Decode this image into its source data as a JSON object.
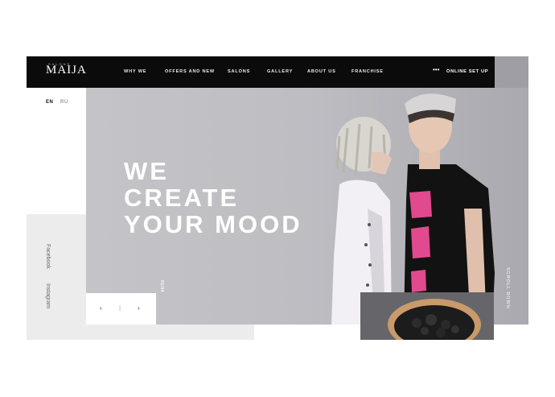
{
  "header": {
    "logo_text": "MAIJA",
    "logo_sub": "SALONS",
    "nav": [
      "WHY WE",
      "OFFERS AND NEW",
      "SALONS",
      "GALLERY",
      "ABOUT US",
      "FRANCHISE"
    ],
    "more_dots": "•••",
    "cta": "ONLINE SET UP"
  },
  "lang": {
    "active": "EN",
    "other": "RU"
  },
  "hero": {
    "lines": [
      "WE",
      "CREATE",
      "YOUR MOOD"
    ],
    "slide_counter": "01/04",
    "scroll_text": "SCROLL DOWN"
  },
  "social": {
    "facebook": "Facebook",
    "instagram": "Instagram"
  },
  "slider": {
    "prev": "‹",
    "sep": "|",
    "next": "›"
  },
  "colors": {
    "nav_bg": "#0b0b0b",
    "hero_bg": "#c0c0c5",
    "accent_pink": "#e14a8e"
  }
}
